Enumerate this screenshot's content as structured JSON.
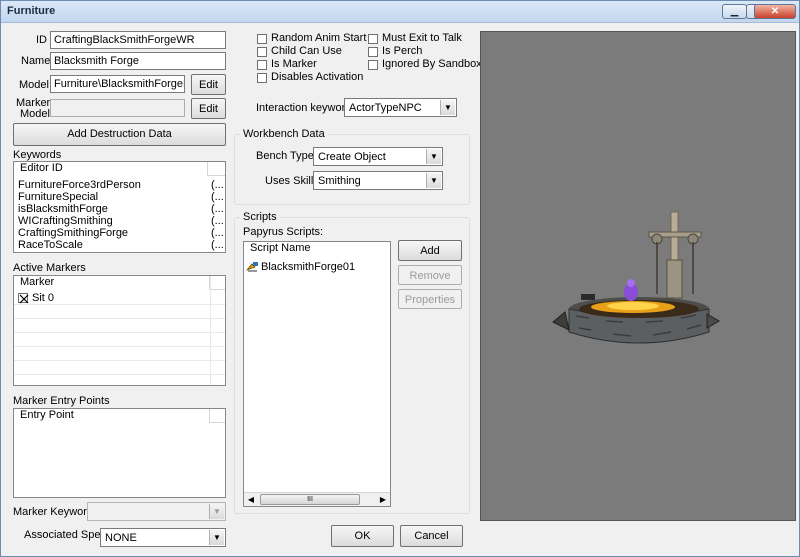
{
  "window": {
    "title": "Furniture",
    "minimize_glyph": "▁",
    "maximize_glyph": "□",
    "close_glyph": "✕"
  },
  "form": {
    "id_label": "ID",
    "id_value": "CraftingBlackSmithForgeWR",
    "name_label": "Name",
    "name_value": "Blacksmith Forge",
    "model_label": "Model",
    "model_value": "Furniture\\BlacksmithForgeMarke",
    "model_edit": "Edit",
    "marker_model_label_1": "Marker",
    "marker_model_label_2": "Model",
    "marker_model_value": "",
    "marker_model_edit": "Edit",
    "add_destruction": "Add Destruction Data"
  },
  "keywords": {
    "label": "Keywords",
    "header": "Editor ID",
    "items": [
      {
        "id": "FurnitureForce3rdPerson",
        "extra": "(..."
      },
      {
        "id": "FurnitureSpecial",
        "extra": "(..."
      },
      {
        "id": "isBlacksmithForge",
        "extra": "(..."
      },
      {
        "id": "WICraftingSmithing",
        "extra": "(..."
      },
      {
        "id": "CraftingSmithingForge",
        "extra": "(..."
      },
      {
        "id": "RaceToScale",
        "extra": "(..."
      }
    ]
  },
  "active_markers": {
    "label": "Active Markers",
    "header": "Marker",
    "items": [
      {
        "label": "Sit 0",
        "checked": true
      }
    ]
  },
  "entry_points": {
    "label": "Marker Entry Points",
    "header": "Entry Point"
  },
  "marker_keyword": {
    "label": "Marker Keyword",
    "value": ""
  },
  "associated_spell": {
    "label": "Associated Spell",
    "value": "NONE"
  },
  "flags": {
    "random_anim_start": "Random Anim Start",
    "child_can_use": "Child Can Use",
    "is_marker": "Is Marker",
    "disables_activation": "Disables Activation",
    "must_exit_to_talk": "Must Exit to Talk",
    "is_perch": "Is Perch",
    "ignored_by_sandbox": "Ignored By Sandbox"
  },
  "interaction": {
    "label": "Interaction keyword",
    "value": "ActorTypeNPC"
  },
  "workbench": {
    "title": "Workbench Data",
    "bench_type_label": "Bench Type",
    "bench_type_value": "Create Object",
    "uses_skill_label": "Uses Skill",
    "uses_skill_value": "Smithing"
  },
  "scripts": {
    "title": "Scripts",
    "papyrus_label": "Papyrus Scripts:",
    "header": "Script Name",
    "items": [
      {
        "name": "BlacksmithForge01"
      }
    ],
    "add": "Add",
    "remove": "Remove",
    "properties": "Properties",
    "scroll_thumb_glyph": "III"
  },
  "dialog": {
    "ok": "OK",
    "cancel": "Cancel"
  },
  "icons": {
    "arrow": "▼",
    "script_icon": "script-icon"
  },
  "colors": {
    "preview_bg": "#7b7b7b",
    "title_bar": "#c2d6ee"
  }
}
